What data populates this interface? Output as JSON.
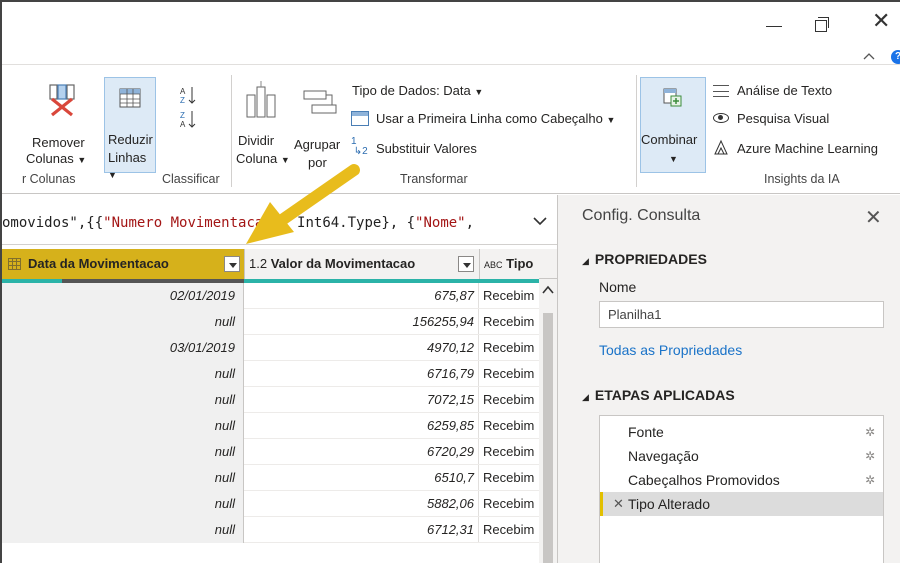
{
  "window": {
    "close_glyph": "✕"
  },
  "ribbon": {
    "remover_colunas": {
      "line1": "Remover",
      "line2": "Colunas"
    },
    "reduzir_linhas": {
      "line1": "Reduzir",
      "line2": "Linhas"
    },
    "dividir_coluna": {
      "line1": "Dividir",
      "line2": "Coluna"
    },
    "agrupar_por": {
      "line1": "Agrupar",
      "line2": "por"
    },
    "tipo_dados": "Tipo de Dados: Data",
    "usar_primeira_linha": "Usar a Primeira Linha como Cabeçalho",
    "substituir_valores": "Substituir Valores",
    "combinar": "Combinar",
    "analise_texto": "Análise de Texto",
    "pesquisa_visual": "Pesquisa Visual",
    "azure_ml": "Azure Machine Learning",
    "groups": {
      "gerenciar_colunas": "r Colunas",
      "classificar": "Classificar",
      "transformar": "Transformar",
      "insights": "Insights da IA"
    }
  },
  "formula": {
    "part1": "omovidos\",{{",
    "str1": "\"Numero Movimentacao\"",
    "part2": ", Int64.Type}, {",
    "str2": "\"Nome\"",
    "part3": ","
  },
  "grid": {
    "columns": [
      {
        "type_icon": "table-icon",
        "label": "Data da Movimentacao"
      },
      {
        "type_icon": "1.2",
        "label": "Valor da Movimentacao"
      },
      {
        "type_icon": "ABC",
        "label": "Tipo"
      }
    ],
    "rows": [
      {
        "date": "02/01/2019",
        "value": "675,87",
        "tipo": "Recebim"
      },
      {
        "date": "null",
        "value": "156255,94",
        "tipo": "Recebim"
      },
      {
        "date": "03/01/2019",
        "value": "4970,12",
        "tipo": "Recebim"
      },
      {
        "date": "null",
        "value": "6716,79",
        "tipo": "Recebim"
      },
      {
        "date": "null",
        "value": "7072,15",
        "tipo": "Recebim"
      },
      {
        "date": "null",
        "value": "6259,85",
        "tipo": "Recebim"
      },
      {
        "date": "null",
        "value": "6720,29",
        "tipo": "Recebim"
      },
      {
        "date": "null",
        "value": "6510,7",
        "tipo": "Recebim"
      },
      {
        "date": "null",
        "value": "5882,06",
        "tipo": "Recebim"
      },
      {
        "date": "null",
        "value": "6712,31",
        "tipo": "Recebim"
      }
    ]
  },
  "query_settings": {
    "title": "Config. Consulta",
    "properties_header": "PROPRIEDADES",
    "name_label": "Nome",
    "name_value": "Planilha1",
    "all_properties": "Todas as Propriedades",
    "steps_header": "ETAPAS APLICADAS",
    "steps": [
      "Fonte",
      "Navegação",
      "Cabeçalhos Promovidos",
      "Tipo Alterado"
    ]
  },
  "colors": {
    "accent_yellow": "#d6b11b",
    "arrow_yellow": "#e8bc1c",
    "link_blue": "#1a73c8"
  }
}
